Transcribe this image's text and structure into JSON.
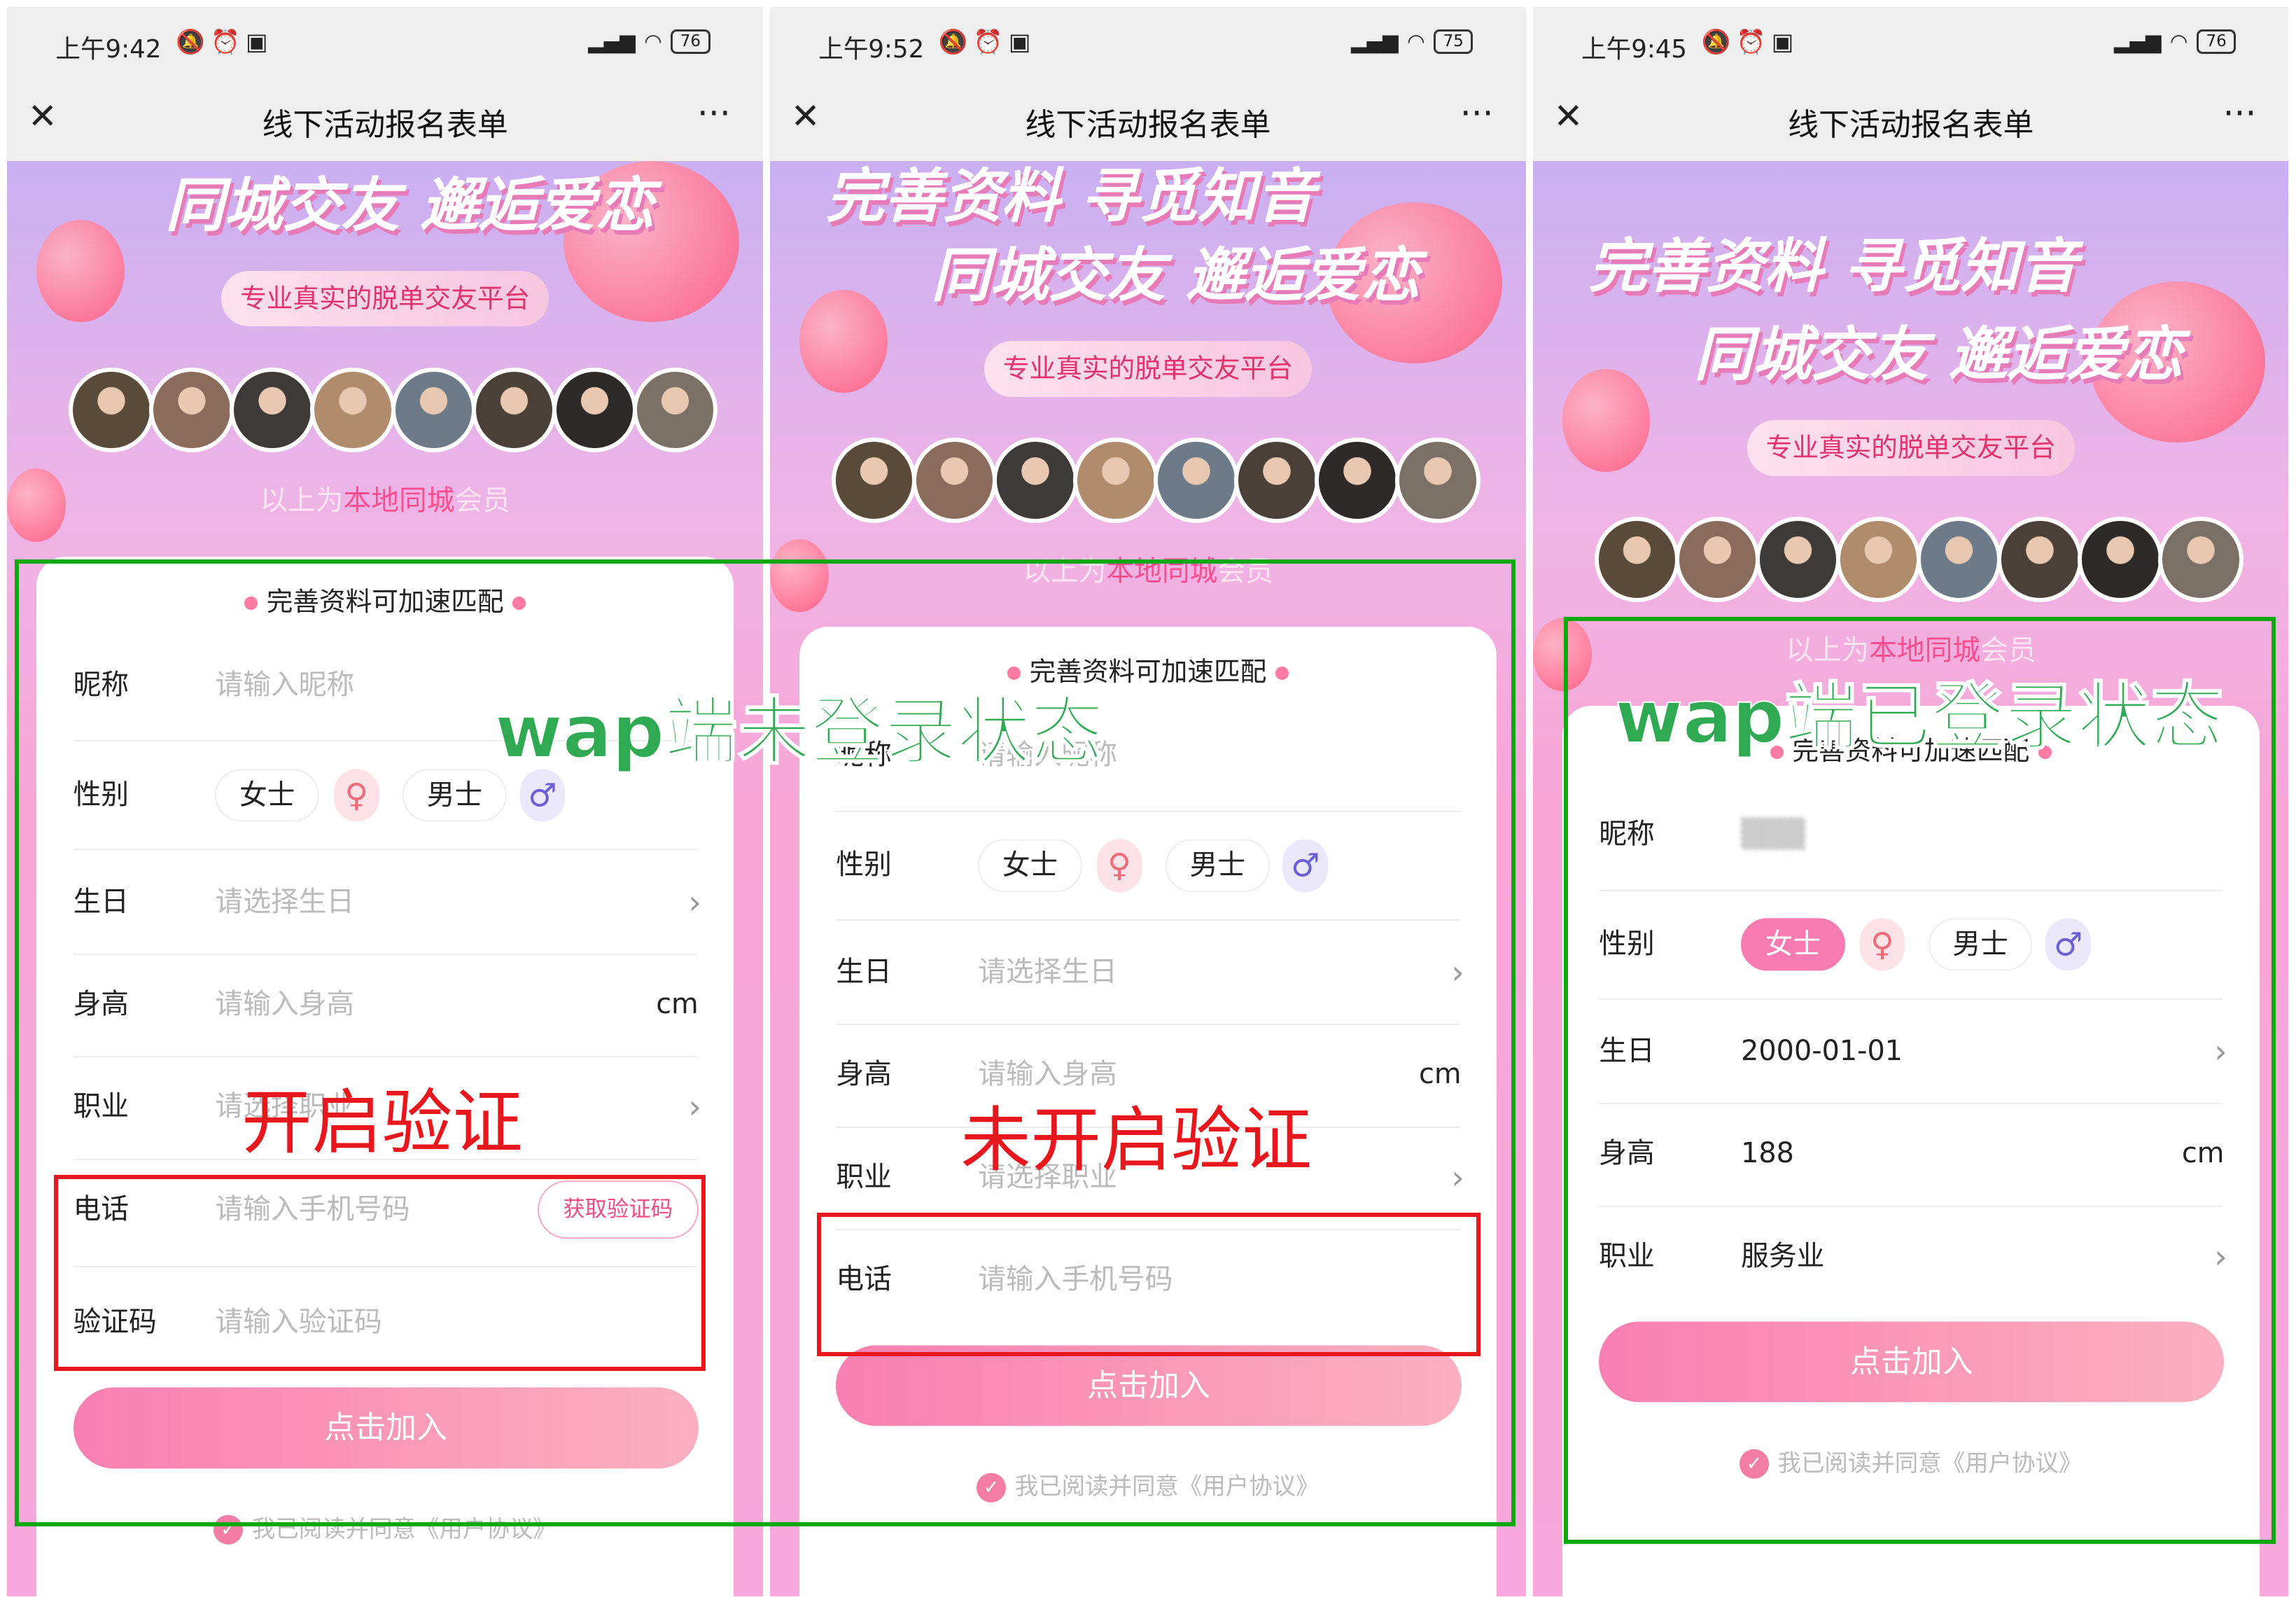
{
  "colors": {
    "accent_pink": "#f97bb2",
    "annotation_green": "#0fa80f",
    "annotation_red": "#e8171d",
    "female_icon_bg": "#fde3e8",
    "male_icon_bg": "#ebe8fb"
  },
  "panels": [
    {
      "time": "上午9:42",
      "battery": "76",
      "title": "线下活动报名表单",
      "banner_lines": [
        "同城交友 邂逅爱恋"
      ],
      "pill": "专业真实的脱单交友平台",
      "members": {
        "pre": "以上为",
        "hl": "本地同城",
        "post": "会员"
      },
      "card_header": "完善资料可加速匹配",
      "fields": [
        {
          "label": "昵称",
          "placeholder": "请输入昵称"
        },
        {
          "label": "性别",
          "type": "gender",
          "female": "女士",
          "male": "男士",
          "selected": ""
        },
        {
          "label": "生日",
          "placeholder": "请选择生日",
          "chevron": true
        },
        {
          "label": "身高",
          "placeholder": "请输入身高",
          "suffix": "cm"
        },
        {
          "label": "职业",
          "placeholder": "请选择职业",
          "chevron": true
        },
        {
          "label": "电话",
          "placeholder": "请输入手机号码",
          "button": "获取验证码"
        },
        {
          "label": "验证码",
          "placeholder": "请输入验证码"
        }
      ],
      "join": "点击加入",
      "agree": "我已阅读并同意《用户协议》"
    },
    {
      "time": "上午9:52",
      "battery": "75",
      "title": "线下活动报名表单",
      "banner_lines": [
        "完善资料 寻觅知音",
        "同城交友 邂逅爱恋"
      ],
      "pill": "专业真实的脱单交友平台",
      "members": {
        "pre": "以上为",
        "hl": "本地同城",
        "post": "会员"
      },
      "card_header": "完善资料可加速匹配",
      "fields": [
        {
          "label": "昵称",
          "placeholder": "请输入昵称"
        },
        {
          "label": "性别",
          "type": "gender",
          "female": "女士",
          "male": "男士",
          "selected": ""
        },
        {
          "label": "生日",
          "placeholder": "请选择生日",
          "chevron": true
        },
        {
          "label": "身高",
          "placeholder": "请输入身高",
          "suffix": "cm"
        },
        {
          "label": "职业",
          "placeholder": "请选择职业",
          "chevron": true
        },
        {
          "label": "电话",
          "placeholder": "请输入手机号码"
        }
      ],
      "join": "点击加入",
      "agree": "我已阅读并同意《用户协议》"
    },
    {
      "time": "上午9:45",
      "battery": "76",
      "title": "线下活动报名表单",
      "banner_lines": [
        "完善资料 寻觅知音",
        "同城交友 邂逅爱恋"
      ],
      "pill": "专业真实的脱单交友平台",
      "members": {
        "pre": "以上为",
        "hl": "本地同城",
        "post": "会员"
      },
      "card_header": "完善资料可加速匹配",
      "fields": [
        {
          "label": "昵称",
          "value": "▒▒▒",
          "blurred": true
        },
        {
          "label": "性别",
          "type": "gender",
          "female": "女士",
          "male": "男士",
          "selected": "female"
        },
        {
          "label": "生日",
          "value": "2000-01-01",
          "chevron": true
        },
        {
          "label": "身高",
          "value": "188",
          "suffix": "cm"
        },
        {
          "label": "职业",
          "value": "服务业",
          "chevron": true
        }
      ],
      "join": "点击加入",
      "agree": "我已阅读并同意《用户协议》"
    }
  ],
  "annotations": {
    "not_logged_in": "wap端未登录状态",
    "logged_in": "wap端已登录状态",
    "verify_on": "开启验证",
    "verify_off": "未开启验证"
  }
}
